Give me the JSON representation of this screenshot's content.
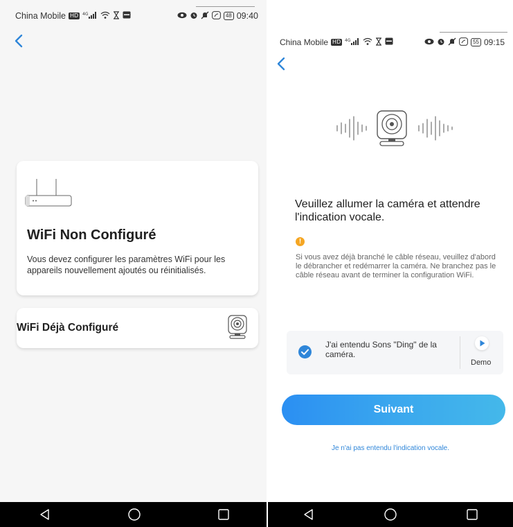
{
  "left_screen": {
    "status_bar": {
      "carrier": "China Mobile",
      "network_badge": "HD",
      "signal": "4G",
      "time": "09:40",
      "battery": "48"
    },
    "card_main": {
      "title": "WiFi Non Configuré",
      "description": "Vous devez configurer les paramètres WiFi pour les appareils nouvellement ajoutés ou réinitialisés."
    },
    "card_second": {
      "title": "WiFi Déjà Configuré"
    }
  },
  "right_screen": {
    "status_bar": {
      "carrier": "China Mobile",
      "network_badge": "HD",
      "signal": "4G",
      "time": "09:15",
      "battery": "55"
    },
    "title": "Veuillez allumer la caméra et attendre l'indication vocale.",
    "warning_icon": "!",
    "note": "Si vous avez déjà branché le câble réseau, veuillez d'abord le débrancher et redémarrer la caméra. Ne branchez pas le câble réseau avant de terminer la configuration WiFi.",
    "confirm": {
      "text": "J'ai entendu Sons \"Ding\" de la caméra.",
      "checked": true,
      "demo_label": "Demo"
    },
    "next_button": "Suivant",
    "not_heard_link": "Je n'ai pas entendu l'indication vocale."
  },
  "colors": {
    "accent": "#2f86d9",
    "warning": "#f5a623",
    "button_gradient_start": "#2b8ff2",
    "button_gradient_end": "#44b8ea",
    "nav_bar": "#000000"
  },
  "icons": [
    "back-chevron-icon",
    "router-icon",
    "camera-icon",
    "sound-wave-icon",
    "warning-icon",
    "check-icon",
    "play-icon",
    "nav-back-icon",
    "nav-home-icon",
    "nav-recents-icon"
  ]
}
